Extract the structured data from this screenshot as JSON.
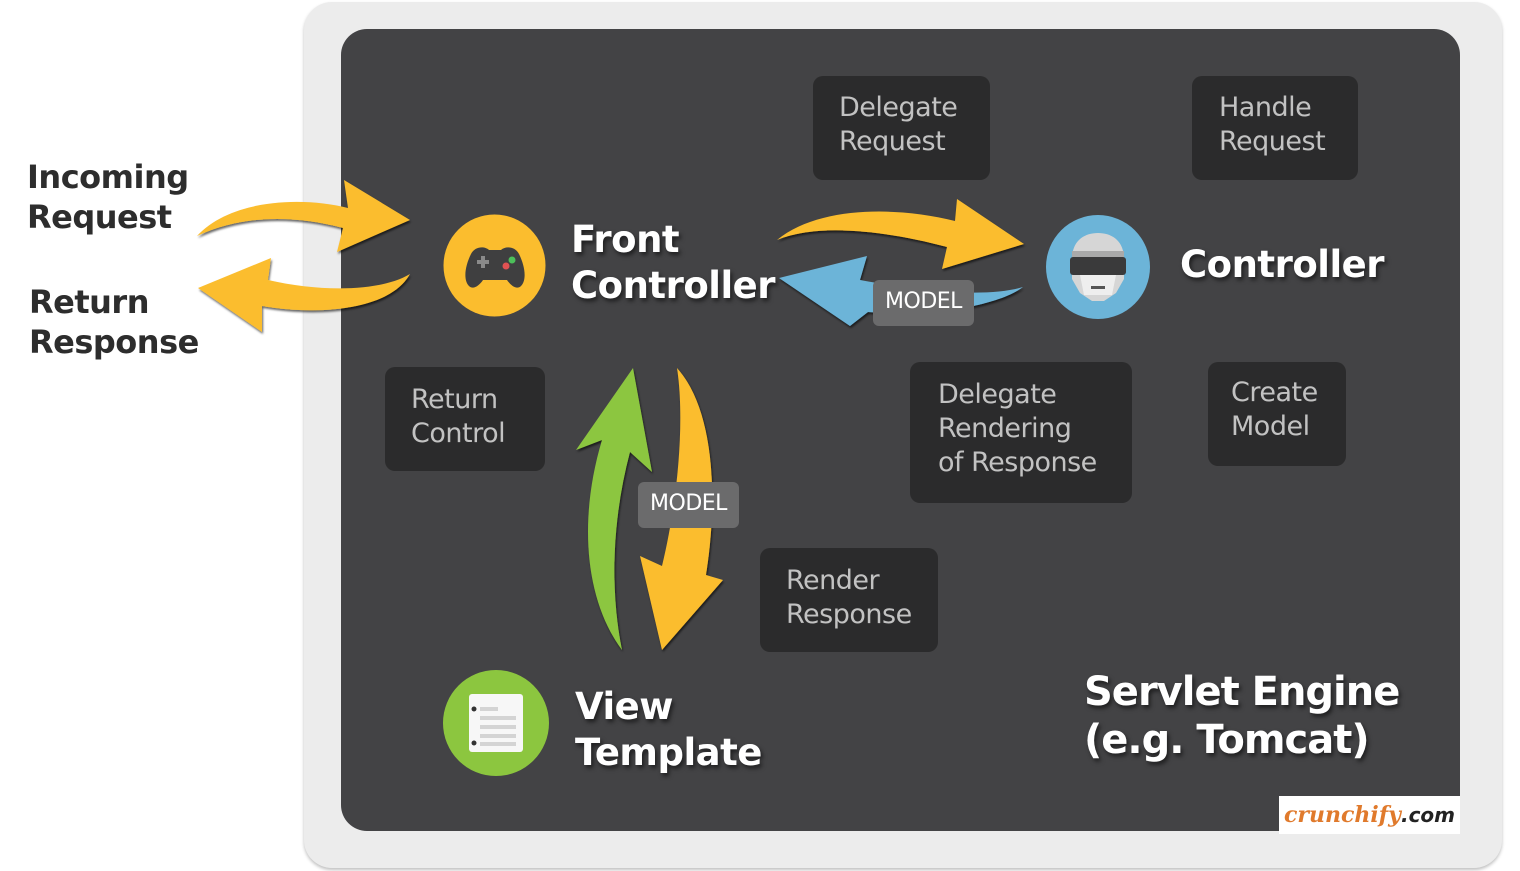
{
  "external": {
    "incoming_request": [
      "Incoming",
      "Request"
    ],
    "return_response": [
      "Return",
      "Response"
    ]
  },
  "nodes": {
    "front_controller": {
      "label": [
        "Front",
        "Controller"
      ],
      "icon": "gamepad-icon",
      "color": "#fbbd2e"
    },
    "controller": {
      "label": [
        "Controller"
      ],
      "icon": "robot-helmet-icon",
      "color": "#6cb4d8"
    },
    "view_template": {
      "label": [
        "View",
        "Template"
      ],
      "icon": "document-icon",
      "color": "#8cc63f"
    }
  },
  "steps": {
    "delegate_request": [
      "Delegate",
      "Request"
    ],
    "handle_request": [
      "Handle",
      "Request"
    ],
    "return_control": [
      "Return",
      "Control"
    ],
    "delegate_rendering": [
      "Delegate",
      "Rendering",
      "of Response"
    ],
    "create_model": [
      "Create",
      "Model"
    ],
    "render_response": [
      "Render",
      "Response"
    ]
  },
  "tags": {
    "model_top": "MODEL",
    "model_left": "MODEL"
  },
  "engine": {
    "title": [
      "Servlet Engine",
      "(e.g. Tomcat)"
    ]
  },
  "brand": {
    "name": "crunchify",
    "suffix": ".com"
  },
  "colors": {
    "arrow_yellow": "#fbbd2e",
    "arrow_blue": "#6cb4d8",
    "arrow_green": "#8cc63f",
    "panel": "#434345",
    "frame": "#ececec",
    "step_box": "#2b2b2c"
  }
}
